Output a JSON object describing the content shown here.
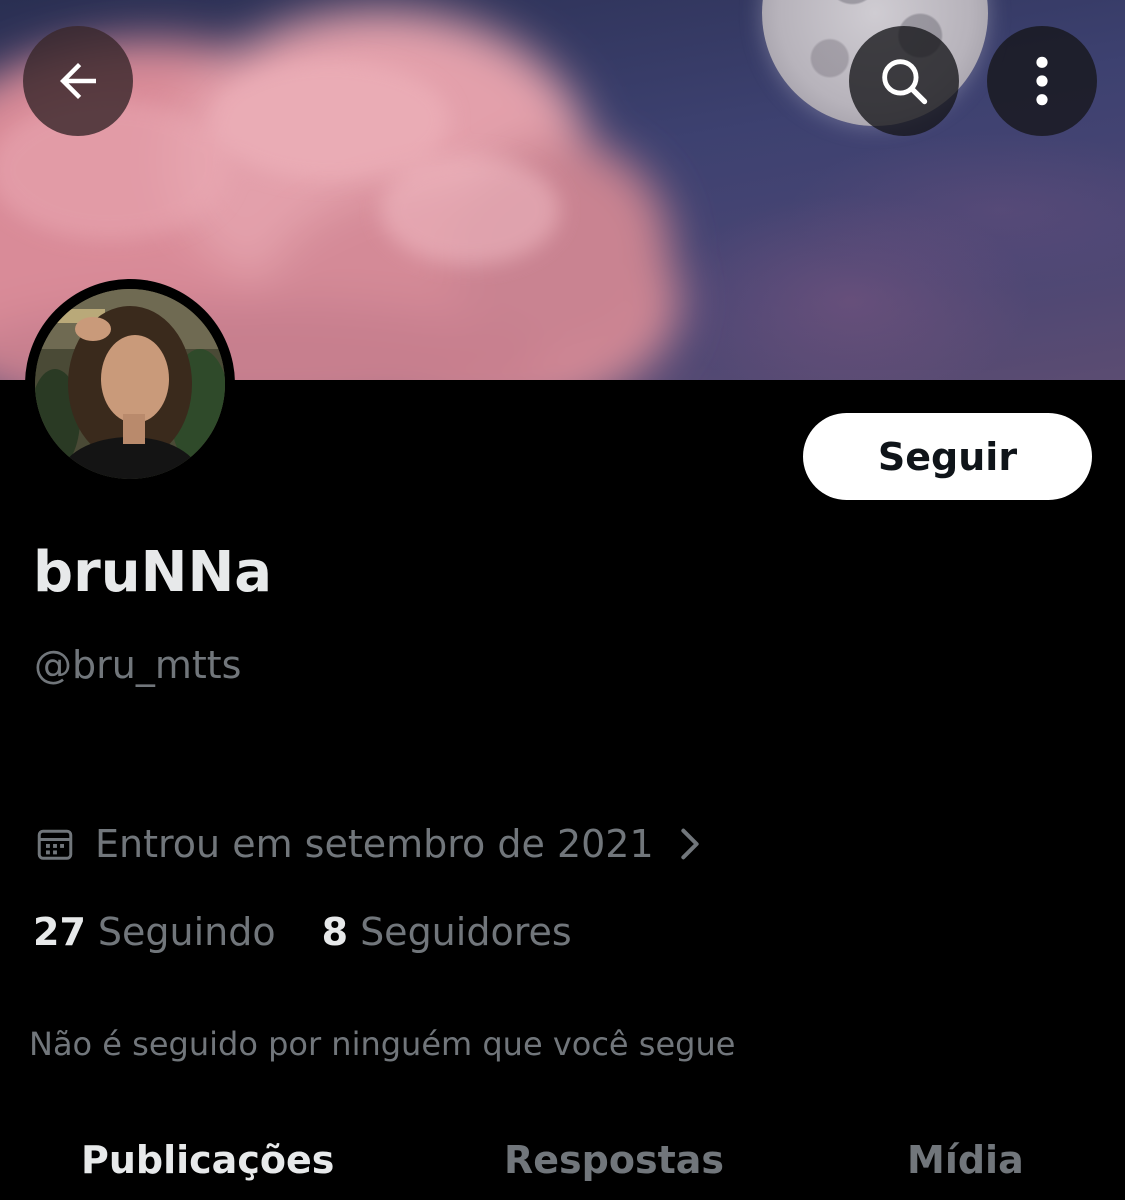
{
  "header": {
    "back_icon": "arrow-left-icon",
    "search_icon": "search-icon",
    "more_icon": "more-vertical-icon"
  },
  "profile": {
    "display_name": "bruNNa",
    "handle": "@bru_mtts",
    "follow_label": "Seguir",
    "joined": "Entrou em setembro de 2021",
    "following_count": "27",
    "following_label": "Seguindo",
    "followers_count": "8",
    "followers_label": "Seguidores",
    "mutuals_note": "Não é seguido por ninguém que você segue"
  },
  "tabs": [
    {
      "label": "Publicações",
      "active": true
    },
    {
      "label": "Respostas",
      "active": false
    },
    {
      "label": "Mídia",
      "active": false
    }
  ],
  "colors": {
    "background": "#000000",
    "primary_text": "#e7e9ea",
    "secondary_text": "#71767b",
    "follow_button_bg": "#ffffff",
    "follow_button_text": "#0f1419"
  }
}
